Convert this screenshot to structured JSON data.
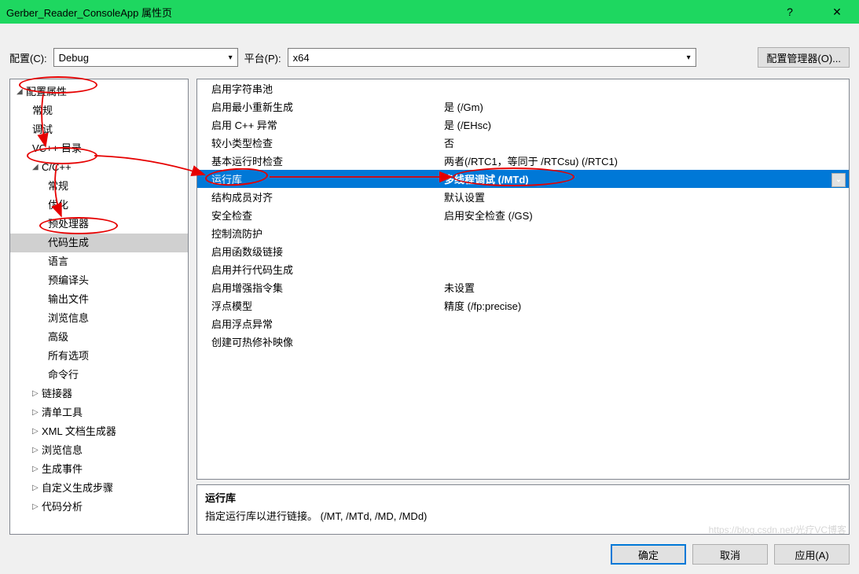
{
  "titlebar": {
    "title": "Gerber_Reader_ConsoleApp 属性页",
    "help": "?",
    "close": "✕"
  },
  "configRow": {
    "configLabel": "配置(C):",
    "configValue": "Debug",
    "platformLabel": "平台(P):",
    "platformValue": "x64",
    "managerBtn": "配置管理器(O)..."
  },
  "tree": {
    "root": "配置属性",
    "items1": [
      "常规",
      "调试",
      "VC++ 目录"
    ],
    "cpp": "C/C++",
    "cppItems": [
      "常规",
      "优化",
      "预处理器",
      "代码生成",
      "语言",
      "预编译头",
      "输出文件",
      "浏览信息",
      "高级",
      "所有选项",
      "命令行"
    ],
    "items2": [
      "链接器",
      "清单工具",
      "XML 文档生成器",
      "浏览信息",
      "生成事件",
      "自定义生成步骤",
      "代码分析"
    ]
  },
  "properties": [
    {
      "name": "启用字符串池",
      "value": ""
    },
    {
      "name": "启用最小重新生成",
      "value": "是 (/Gm)"
    },
    {
      "name": "启用 C++ 异常",
      "value": "是 (/EHsc)"
    },
    {
      "name": "较小类型检查",
      "value": "否"
    },
    {
      "name": "基本运行时检查",
      "value": "两者(/RTC1，等同于 /RTCsu) (/RTC1)"
    },
    {
      "name": "运行库",
      "value": "多线程调试 (/MTd)",
      "selected": true
    },
    {
      "name": "结构成员对齐",
      "value": "默认设置"
    },
    {
      "name": "安全检查",
      "value": "启用安全检查 (/GS)"
    },
    {
      "name": "控制流防护",
      "value": ""
    },
    {
      "name": "启用函数级链接",
      "value": ""
    },
    {
      "name": "启用并行代码生成",
      "value": ""
    },
    {
      "name": "启用增强指令集",
      "value": "未设置"
    },
    {
      "name": "浮点模型",
      "value": "精度 (/fp:precise)"
    },
    {
      "name": "启用浮点异常",
      "value": ""
    },
    {
      "name": "创建可热修补映像",
      "value": ""
    }
  ],
  "description": {
    "title": "运行库",
    "text": "指定运行库以进行链接。     (/MT, /MTd, /MD, /MDd)"
  },
  "buttons": {
    "ok": "确定",
    "cancel": "取消",
    "apply": "应用(A)"
  },
  "watermark": "https://blog.csdn.net/光疗VC博客"
}
